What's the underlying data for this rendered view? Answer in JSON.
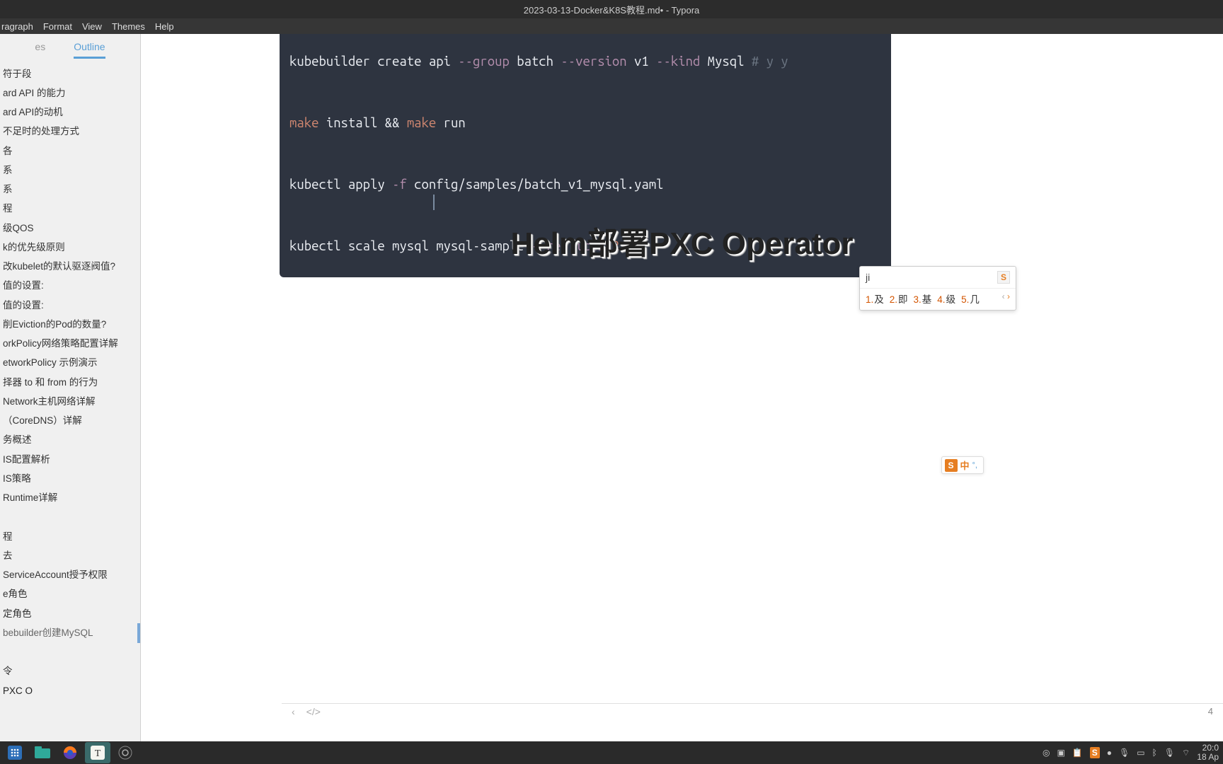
{
  "titlebar": "2023-03-13-Docker&K8S教程.md• - Typora",
  "menu": {
    "paragraph": "ragraph",
    "format": "Format",
    "view": "View",
    "themes": "Themes",
    "help": "Help"
  },
  "tabs": {
    "files": "es",
    "outline": "Outline"
  },
  "outline": {
    "items": [
      "符于段",
      "ard API 的能力",
      "ard API的动机",
      "不足时的处理方式",
      "各",
      "系",
      "系",
      "程",
      "级QOS",
      "k的优先级原则",
      "改kubelet的默认驱逐阀值?",
      "值的设置:",
      "值的设置:",
      "削Eviction的Pod的数量?",
      "orkPolicy网络策略配置详解",
      "etworkPolicy 示例演示",
      "择器 to 和 from 的行为",
      "Network主机网络详解",
      "（CoreDNS）详解",
      "务概述",
      "IS配置解析",
      "IS策略",
      "Runtime详解",
      "",
      "程",
      "去",
      "ServiceAccount授予权限",
      "e角色",
      "定角色",
      "bebuilder创建MySQL",
      "",
      "令",
      "PXC O"
    ],
    "active_index": 29
  },
  "code": {
    "line1": {
      "a": "kubebuilder create api",
      "b": "--group",
      "c": "batch",
      "d": "--version",
      "e": "v1",
      "f": "--kind",
      "g": "Mysql",
      "h": "# y y"
    },
    "line2": {
      "a": "make",
      "b": "install &&",
      "c": "make",
      "d": "run"
    },
    "line3": {
      "a": "kubectl apply",
      "b": "-f",
      "c": "config/samples/batch_v1_mysql.yaml"
    },
    "line4": {
      "a": "kubectl scale mysql mysql-sample",
      "b": "--replicas",
      "c": "2"
    }
  },
  "heading": "Helm部署PXC Operator",
  "ime": {
    "input": "ji",
    "logo": "S",
    "candidates": [
      {
        "n": "1.",
        "c": "及"
      },
      {
        "n": "2.",
        "c": "即"
      },
      {
        "n": "3.",
        "c": "基"
      },
      {
        "n": "4.",
        "c": "级"
      },
      {
        "n": "5.",
        "c": "几"
      }
    ],
    "prev": "‹",
    "next": "›"
  },
  "float_ime": {
    "logo": "S",
    "lang": "中",
    "punct": "°,"
  },
  "statusbar": {
    "back": "‹",
    "code": "</>",
    "words": "4"
  },
  "taskbar": {
    "tray": {
      "obs": "◎",
      "term": "▣",
      "clip": "📋",
      "sogou": "S",
      "bulb": "●",
      "mic": "🎙",
      "batt": "▭",
      "bt": "ᛒ",
      "mic2": "🎙",
      "wifi": "⌔"
    },
    "time": "20:0",
    "date": "18 Ap"
  },
  "chart_data": null
}
